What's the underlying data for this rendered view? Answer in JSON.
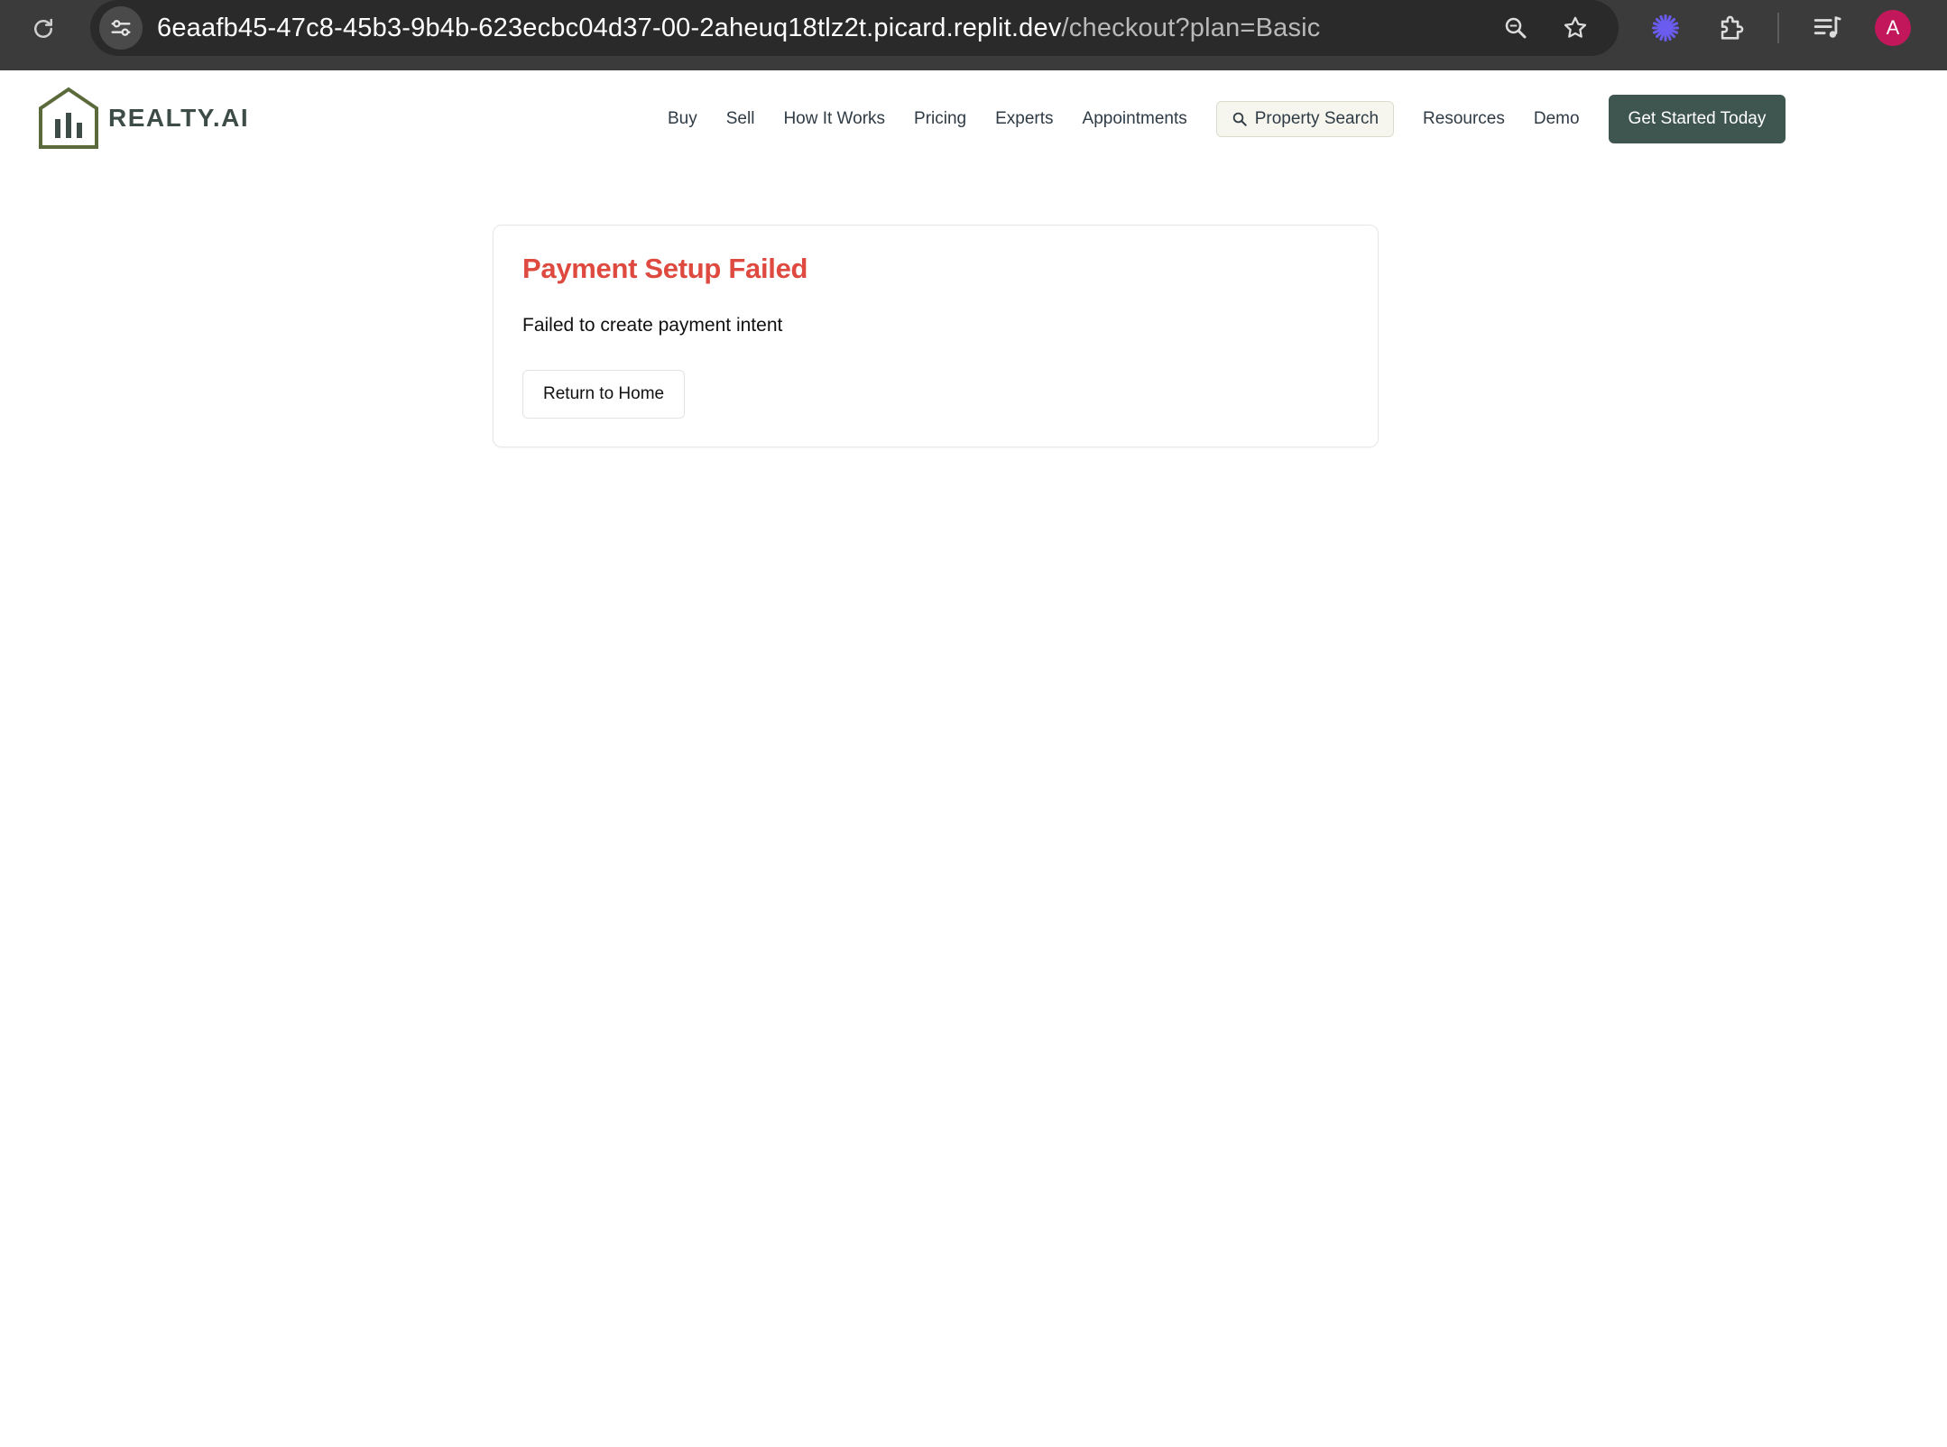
{
  "browser": {
    "url_host": "6eaafb45-47c8-45b3-9b4b-623ecbc04d37-00-2aheuq18tlz2t.picard.replit.dev",
    "url_path": "/checkout?plan=Basic",
    "avatar_letter": "A",
    "icons": [
      "reload-icon",
      "site-info-icon",
      "zoom-icon",
      "bookmark-star-icon",
      "extension-gear-icon",
      "extensions-puzzle-icon",
      "media-queue-icon"
    ],
    "colors": {
      "chrome_bg": "#3b3b3b",
      "omnibox_bg": "#2a2a2a",
      "avatar_bg": "#c2185b",
      "extension_accent": "#6b5cf0"
    }
  },
  "header": {
    "logo_text": "REALTY.AI",
    "nav": [
      "Buy",
      "Sell",
      "How It Works",
      "Pricing",
      "Experts",
      "Appointments"
    ],
    "search_label": "Property Search",
    "nav_after": [
      "Resources",
      "Demo"
    ],
    "cta_label": "Get Started Today",
    "colors": {
      "logo": "#5b6a3a",
      "cta_bg": "#3f5550"
    }
  },
  "card": {
    "title": "Payment Setup Failed",
    "message": "Failed to create payment intent",
    "button_label": "Return to Home",
    "colors": {
      "title": "#de4a3f"
    }
  }
}
